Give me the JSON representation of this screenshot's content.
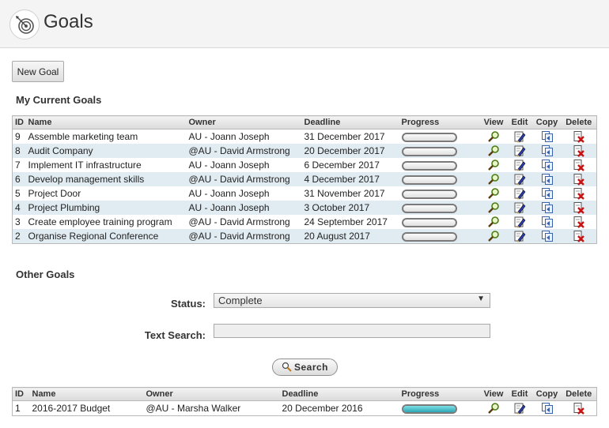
{
  "app": {
    "title": "Goals",
    "logo_icon": "target-icon"
  },
  "toolbar": {
    "new_goal_label": "New Goal"
  },
  "current_goals": {
    "title": "My Current Goals",
    "columns": {
      "id": "ID",
      "name": "Name",
      "owner": "Owner",
      "deadline": "Deadline",
      "progress": "Progress",
      "view": "View",
      "edit": "Edit",
      "copy": "Copy",
      "delete": "Delete"
    },
    "rows": [
      {
        "id": "9",
        "name": "Assemble marketing team",
        "owner": "AU - Joann Joseph",
        "deadline": "31 December 2017",
        "progress": 0
      },
      {
        "id": "8",
        "name": "Audit Company",
        "owner": "@AU - David Armstrong",
        "deadline": "20 December 2017",
        "progress": 0
      },
      {
        "id": "7",
        "name": "Implement IT infrastructure",
        "owner": "AU - Joann Joseph",
        "deadline": "6 December 2017",
        "progress": 0
      },
      {
        "id": "6",
        "name": "Develop management skills",
        "owner": "@AU - David Armstrong",
        "deadline": "4 December 2017",
        "progress": 0
      },
      {
        "id": "5",
        "name": "Project Door",
        "owner": "AU - Joann Joseph",
        "deadline": "31 November 2017",
        "progress": 0
      },
      {
        "id": "4",
        "name": "Project Plumbing",
        "owner": "AU - Joann Joseph",
        "deadline": "3 October 2017",
        "progress": 0
      },
      {
        "id": "3",
        "name": "Create employee training program",
        "owner": "@AU - David Armstrong",
        "deadline": "24 September 2017",
        "progress": 0
      },
      {
        "id": "2",
        "name": "Organise Regional Conference",
        "owner": "@AU - David Armstrong",
        "deadline": "20 August 2017",
        "progress": 0
      }
    ]
  },
  "other_goals": {
    "title": "Other Goals",
    "status_label": "Status:",
    "status_value": "Complete",
    "text_search_label": "Text Search:",
    "text_search_value": "",
    "search_label": "Search",
    "columns": {
      "id": "ID",
      "name": "Name",
      "owner": "Owner",
      "deadline": "Deadline",
      "progress": "Progress",
      "view": "View",
      "edit": "Edit",
      "copy": "Copy",
      "delete": "Delete"
    },
    "rows": [
      {
        "id": "1",
        "name": "2016-2017 Budget",
        "owner": "@AU - Marsha Walker",
        "deadline": "20 December 2016",
        "progress": 1
      }
    ]
  },
  "icons": {
    "view": "magnifier-icon",
    "edit": "edit-pencil-icon",
    "copy": "copy-icon",
    "delete": "delete-icon"
  },
  "colors": {
    "alt_row": "#e1ecf2",
    "progress_fill": "#2aa6b3",
    "header_bg": "#f4f4f4"
  }
}
